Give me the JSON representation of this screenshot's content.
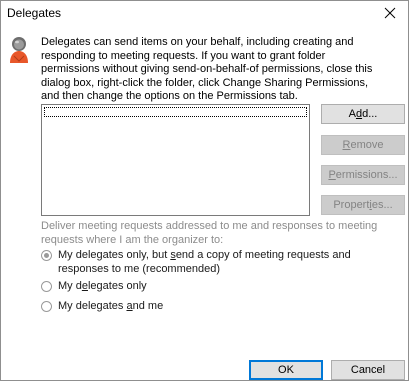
{
  "window": {
    "title": "Delegates"
  },
  "intro_text": "Delegates can send items on your behalf, including creating and responding to meeting requests. If you want to grant folder permissions without giving send-on-behalf-of permissions, close this dialog box, right-click the folder, click Change Sharing Permissions, and then change the options on the Permissions tab.",
  "buttons": {
    "add": {
      "pre": "A",
      "key": "d",
      "post": "d..."
    },
    "remove": {
      "pre": "",
      "key": "R",
      "post": "emove"
    },
    "permissions": {
      "pre": "",
      "key": "P",
      "post": "ermissions..."
    },
    "properties": {
      "pre": "Propert",
      "key": "i",
      "post": "es..."
    },
    "ok": "OK",
    "cancel": "Cancel"
  },
  "deliver_label": "Deliver meeting requests addressed to me and responses to meeting requests where I am the organizer to:",
  "options": [
    {
      "pre": "My delegates only, but ",
      "key": "s",
      "post": "end a copy of meeting requests and responses to me (recommended)",
      "checked": true
    },
    {
      "pre": "My d",
      "key": "e",
      "post": "legates only",
      "checked": false
    },
    {
      "pre": "My delegates ",
      "key": "a",
      "post": "nd me",
      "checked": false
    }
  ],
  "colors": {
    "accent": "#0078d7",
    "disabled_text": "#838383"
  }
}
